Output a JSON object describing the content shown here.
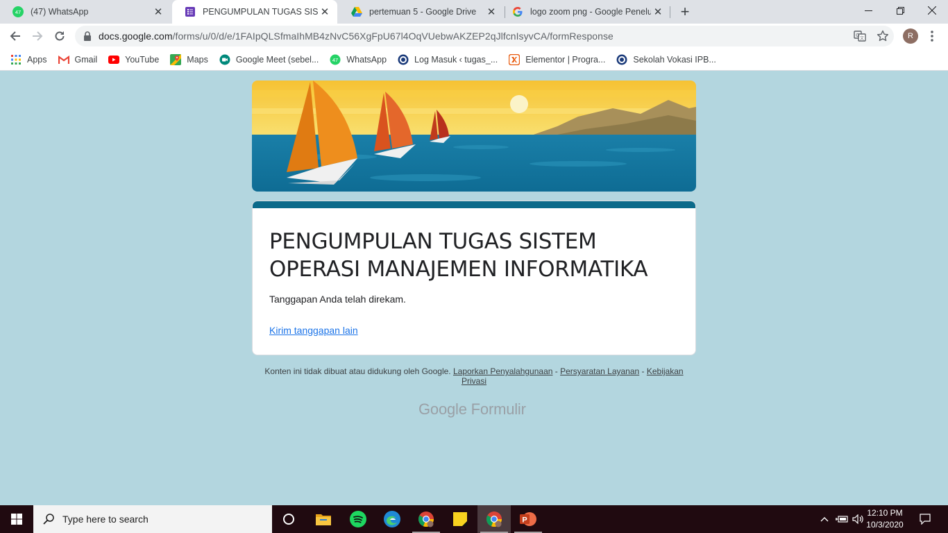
{
  "tabs": [
    {
      "title": "(47) WhatsApp",
      "badge": "47",
      "favicon": "whatsapp-icon",
      "active": false
    },
    {
      "title": "PENGUMPULAN TUGAS SISTEM",
      "favicon": "google-forms-icon",
      "active": true
    },
    {
      "title": "pertemuan 5 - Google Drive",
      "favicon": "google-drive-icon",
      "active": false
    },
    {
      "title": "logo zoom png - Google Penelus",
      "favicon": "google-icon",
      "active": false
    }
  ],
  "toolbar": {
    "url_host": "docs.google.com",
    "url_path": "/forms/u/0/d/e/1FAIpQLSfmaIhMB4zNvC56XgFpU67l4OqVUebwAKZEP2qJlfcnIsyvCA/formResponse",
    "profile_initial": "R"
  },
  "bookmarks": [
    {
      "label": "Apps",
      "icon": "apps-grid-icon"
    },
    {
      "label": "Gmail",
      "icon": "gmail-icon"
    },
    {
      "label": "YouTube",
      "icon": "youtube-icon"
    },
    {
      "label": "Maps",
      "icon": "maps-icon"
    },
    {
      "label": "Google Meet (sebel...",
      "icon": "google-meet-icon"
    },
    {
      "label": "WhatsApp",
      "icon": "whatsapp-icon",
      "badge": "47"
    },
    {
      "label": "Log Masuk ‹ tugas_...",
      "icon": "ipb-logo-icon"
    },
    {
      "label": "Elementor | Progra...",
      "icon": "elementor-icon"
    },
    {
      "label": "Sekolah Vokasi IPB...",
      "icon": "ipb-logo-icon"
    }
  ],
  "form": {
    "title": "PENGUMPULAN TUGAS SISTEM OPERASI MANAJEMEN INFORMATIKA",
    "confirmation": "Tanggapan Anda telah direkam.",
    "another_link": "Kirim tanggapan lain",
    "accent_color": "#0b6a8a"
  },
  "footer": {
    "disclaimer": "Konten ini tidak dibuat atau didukung oleh Google.",
    "link_abuse": "Laporkan Penyalahgunaan",
    "link_terms": "Persyaratan Layanan",
    "link_privacy": "Kebijakan Privasi",
    "sep": " - ",
    "brand_google": "Google",
    "brand_product": "Formulir"
  },
  "taskbar": {
    "search_placeholder": "Type here to search",
    "apps": [
      "cortana-icon",
      "file-explorer-icon",
      "spotify-icon",
      "edge-icon",
      "chrome-icon",
      "sticky-notes-icon",
      "chrome-icon",
      "powerpoint-icon"
    ],
    "time": "12:10 PM",
    "date": "10/3/2020"
  },
  "colors": {
    "page_background": "#b3d6df",
    "link": "#1a73e8",
    "taskbar": "#200a10"
  }
}
